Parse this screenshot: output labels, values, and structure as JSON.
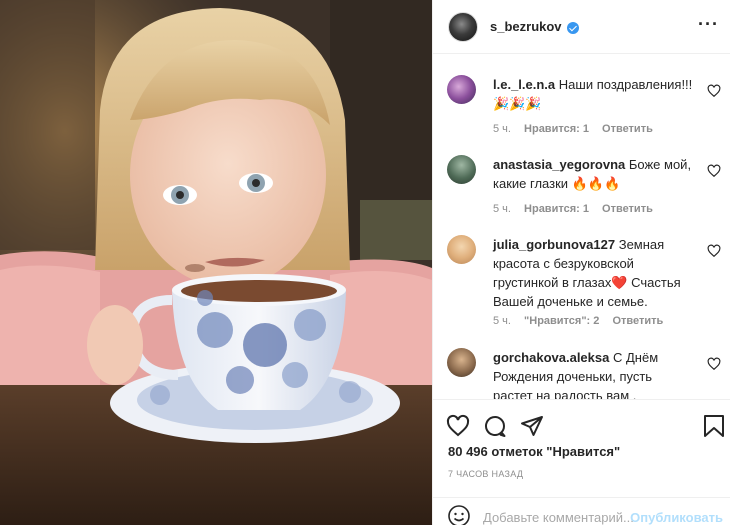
{
  "post": {
    "author": "s_bezrukov",
    "likes_text": "80 496 отметок \"Нравится\"",
    "time_text": "7 ЧАСОВ НАЗАД"
  },
  "comments": [
    {
      "user": "l.e._l.e.n.a",
      "text": "Наши поздравления!!!",
      "emoji": "🎉🎉🎉",
      "age": "5 ч.",
      "likes": "Нравится: 1",
      "reply": "Ответить"
    },
    {
      "user": "anastasia_yegorovna",
      "text": "Боже мой, какие глазки",
      "emoji": "🔥🔥🔥",
      "age": "5 ч.",
      "likes": "Нравится: 1",
      "reply": "Ответить"
    },
    {
      "user": "julia_gorbunova127",
      "text": "Земная красота с безруковской грустинкой в глазах",
      "emoji": "❤️",
      "text2": "Счастья Вашей доченьке и семье.",
      "age": "5 ч.",
      "likes": "\"Нравится\": 2",
      "reply": "Ответить"
    },
    {
      "user": "gorchakova.aleksa",
      "text": "С Днём Рождения доченьки, пусть растет на радость вам ,"
    }
  ],
  "add_comment": {
    "placeholder": "Добавьте комментарий...",
    "publish_label": "Опубликовать"
  },
  "colors": {
    "verified": "#3897f0",
    "publish": "#b2dffc",
    "meta": "#8e8e8e"
  }
}
